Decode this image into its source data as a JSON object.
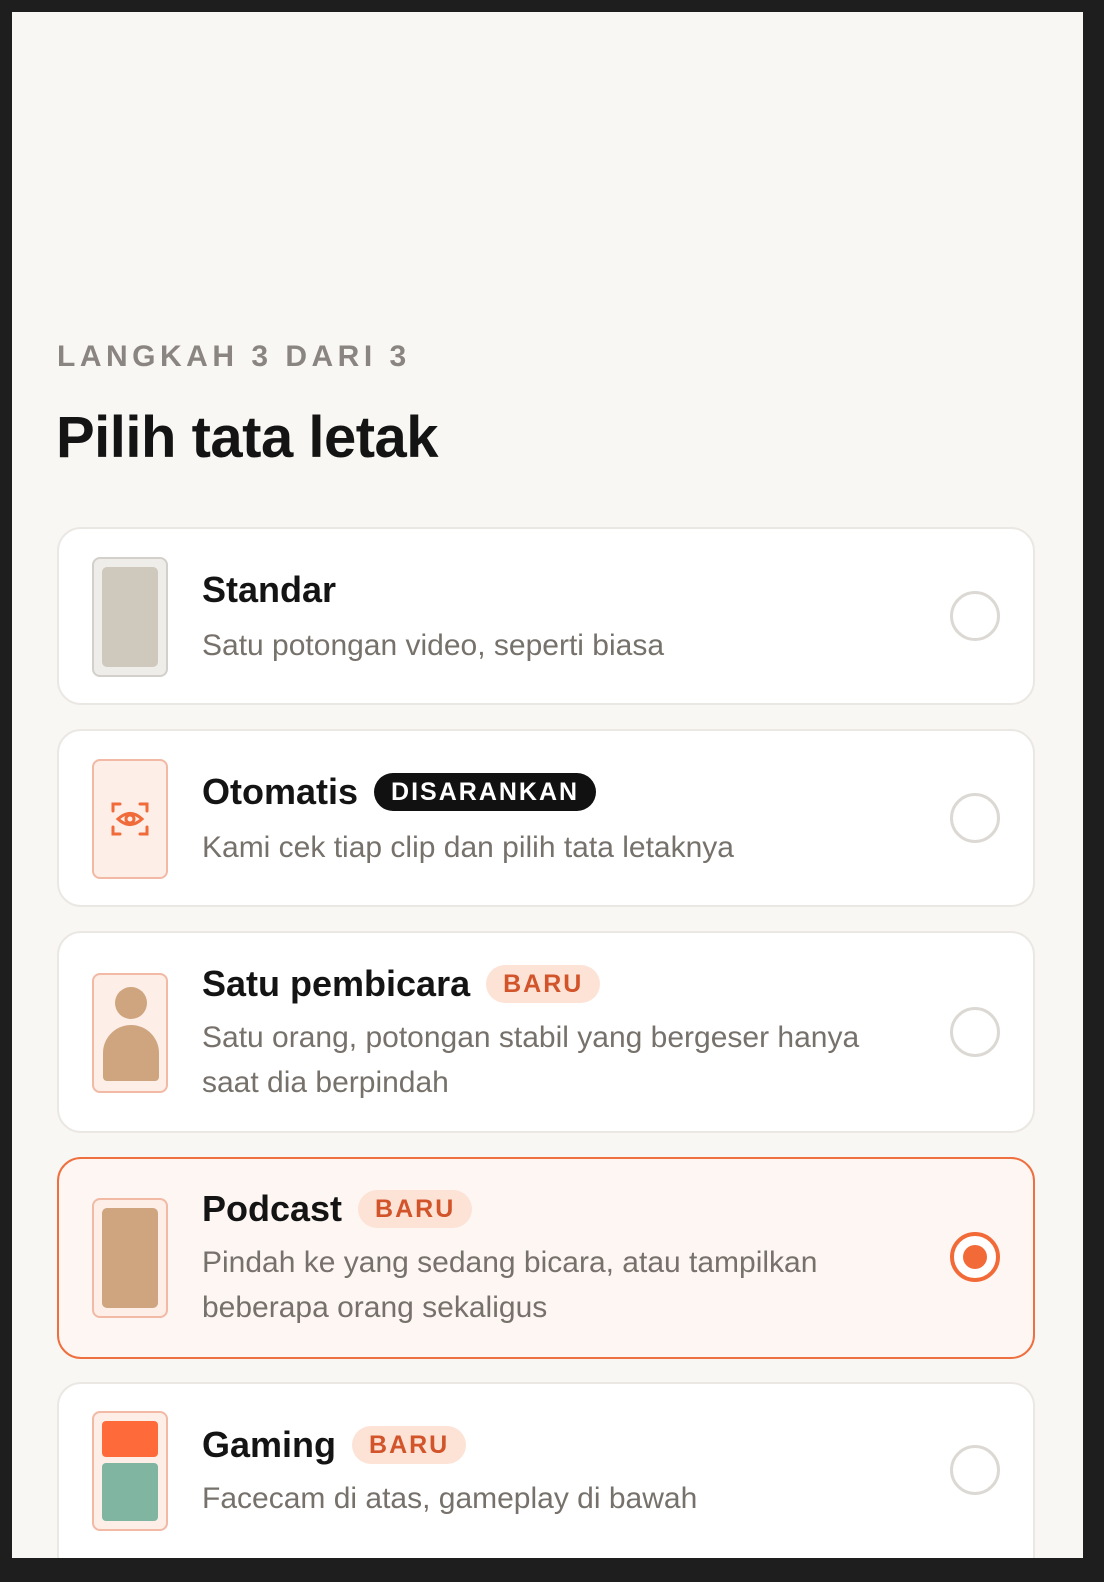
{
  "header": {
    "step_label": "LANGKAH 3 DARI 3",
    "title": "Pilih tata letak"
  },
  "options": [
    {
      "id": "standar",
      "title": "Standar",
      "badge": "",
      "description": "Satu potongan video, seperti biasa",
      "selected": false,
      "icon": "single-frame-icon"
    },
    {
      "id": "otomatis",
      "title": "Otomatis",
      "badge": "DISARANKAN",
      "description": "Kami cek tiap clip dan pilih tata letaknya",
      "selected": false,
      "icon": "eye-scan-icon"
    },
    {
      "id": "satu-pembicara",
      "title": "Satu pembicara",
      "badge": "BARU",
      "description": "Satu orang, potongan stabil yang bergeser hanya saat dia berpindah",
      "selected": false,
      "icon": "person-icon"
    },
    {
      "id": "podcast",
      "title": "Podcast",
      "badge": "BARU",
      "description": "Pindah ke yang sedang bicara, atau tampilkan beberapa orang sekaligus",
      "selected": true,
      "icon": "podcast-frame-icon"
    },
    {
      "id": "gaming",
      "title": "Gaming",
      "badge": "BARU",
      "description": "Facecam di atas, gameplay di bawah",
      "selected": false,
      "icon": "split-frame-icon"
    }
  ],
  "colors": {
    "accent": "#f26a38",
    "background": "#f8f7f4",
    "thumb_gray": "#cfc8bc",
    "thumb_tan": "#cea57e",
    "facecam": "#ff6a3a",
    "gameplay": "#7fb5a1"
  }
}
